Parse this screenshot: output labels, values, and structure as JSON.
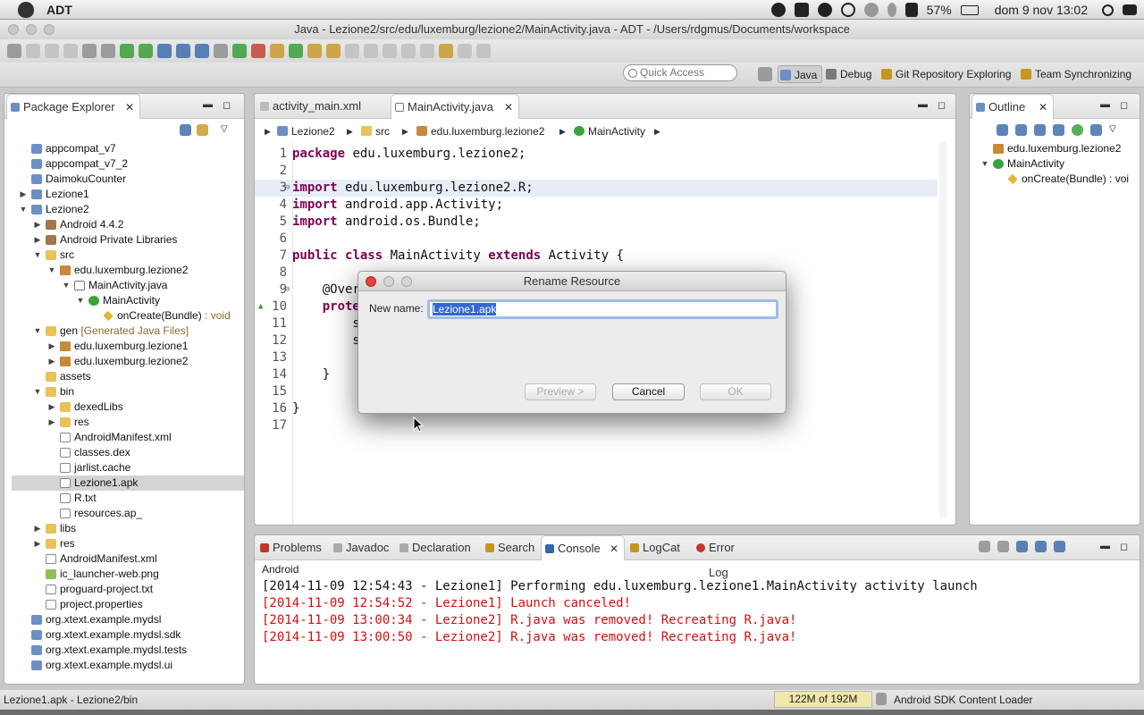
{
  "menubar": {
    "app": "ADT",
    "battery": "57%",
    "datetime": "dom 9 nov  13:02"
  },
  "window": {
    "title": "Java - Lezione2/src/edu/luxemburg/lezione2/MainActivity.java - ADT - /Users/rdgmus/Documents/workspace"
  },
  "toolbar": {
    "quick_access_placeholder": "Quick Access"
  },
  "perspectives": [
    {
      "label": "Java",
      "active": true
    },
    {
      "label": "Debug"
    },
    {
      "label": "Git Repository Exploring"
    },
    {
      "label": "Team Synchronizing"
    }
  ],
  "package_explorer": {
    "title": "Package Explorer",
    "items": [
      {
        "label": "appcompat_v7",
        "depth": 0,
        "icon": "project-icon"
      },
      {
        "label": "appcompat_v7_2",
        "depth": 0,
        "icon": "project-icon"
      },
      {
        "label": "DaimokuCounter",
        "depth": 0,
        "icon": "project-icon"
      },
      {
        "label": "Lezione1",
        "depth": 0,
        "icon": "project-icon",
        "twisty": "collapsed"
      },
      {
        "label": "Lezione2",
        "depth": 0,
        "icon": "project-icon",
        "twisty": "expanded"
      },
      {
        "label": "Android 4.4.2",
        "depth": 1,
        "icon": "library-icon",
        "twisty": "collapsed"
      },
      {
        "label": "Android Private Libraries",
        "depth": 1,
        "icon": "library-icon",
        "twisty": "collapsed"
      },
      {
        "label": "src",
        "depth": 1,
        "icon": "folder-icon",
        "twisty": "expanded"
      },
      {
        "label": "edu.luxemburg.lezione2",
        "depth": 2,
        "icon": "package-icon",
        "twisty": "expanded"
      },
      {
        "label": "MainActivity.java",
        "depth": 3,
        "icon": "java-file-icon",
        "twisty": "expanded"
      },
      {
        "label": "MainActivity",
        "depth": 4,
        "icon": "class-icon",
        "twisty": "expanded"
      },
      {
        "label": "onCreate(Bundle)",
        "decoration": " : void",
        "depth": 5,
        "icon": "method-icon"
      },
      {
        "label": "gen",
        "decoration": " [Generated Java Files]",
        "depth": 1,
        "icon": "folder-icon",
        "twisty": "expanded"
      },
      {
        "label": "edu.luxemburg.lezione1",
        "depth": 2,
        "icon": "package-icon",
        "twisty": "collapsed"
      },
      {
        "label": "edu.luxemburg.lezione2",
        "depth": 2,
        "icon": "package-icon",
        "twisty": "collapsed"
      },
      {
        "label": "assets",
        "depth": 1,
        "icon": "folder-icon"
      },
      {
        "label": "bin",
        "depth": 1,
        "icon": "folder-icon",
        "twisty": "expanded"
      },
      {
        "label": "dexedLibs",
        "depth": 2,
        "icon": "folder-icon",
        "twisty": "collapsed"
      },
      {
        "label": "res",
        "depth": 2,
        "icon": "folder-icon",
        "twisty": "collapsed"
      },
      {
        "label": "AndroidManifest.xml",
        "depth": 2,
        "icon": "file-icon"
      },
      {
        "label": "classes.dex",
        "depth": 2,
        "icon": "file-icon"
      },
      {
        "label": "jarlist.cache",
        "depth": 2,
        "icon": "file-icon"
      },
      {
        "label": "Lezione1.apk",
        "depth": 2,
        "icon": "file-icon",
        "selected": true
      },
      {
        "label": "R.txt",
        "depth": 2,
        "icon": "file-icon"
      },
      {
        "label": "resources.ap_",
        "depth": 2,
        "icon": "file-icon"
      },
      {
        "label": "libs",
        "depth": 1,
        "icon": "folder-icon",
        "twisty": "collapsed"
      },
      {
        "label": "res",
        "depth": 1,
        "icon": "folder-icon",
        "twisty": "collapsed"
      },
      {
        "label": "AndroidManifest.xml",
        "depth": 1,
        "icon": "file-icon"
      },
      {
        "label": "ic_launcher-web.png",
        "depth": 1,
        "icon": "image-icon"
      },
      {
        "label": "proguard-project.txt",
        "depth": 1,
        "icon": "file-icon"
      },
      {
        "label": "project.properties",
        "depth": 1,
        "icon": "file-icon"
      },
      {
        "label": "org.xtext.example.mydsl",
        "depth": 0,
        "icon": "project-icon"
      },
      {
        "label": "org.xtext.example.mydsl.sdk",
        "depth": 0,
        "icon": "project-icon"
      },
      {
        "label": "org.xtext.example.mydsl.tests",
        "depth": 0,
        "icon": "project-icon"
      },
      {
        "label": "org.xtext.example.mydsl.ui",
        "depth": 0,
        "icon": "project-icon"
      }
    ]
  },
  "editor": {
    "tabs": [
      {
        "label": "activity_main.xml",
        "active": false
      },
      {
        "label": "MainActivity.java",
        "active": true
      }
    ],
    "breadcrumb": [
      "Lezione2",
      "src",
      "edu.luxemburg.lezione2",
      "MainActivity"
    ],
    "lines": [
      {
        "n": "1",
        "parts": [
          {
            "kw": "package"
          },
          {
            "t": " edu.luxemburg.lezione2;"
          }
        ]
      },
      {
        "n": "2",
        "parts": []
      },
      {
        "n": "3",
        "fold": true,
        "hl": true,
        "parts": [
          {
            "kw": "import"
          },
          {
            "t": " edu.luxemburg.lezione2.R;"
          }
        ]
      },
      {
        "n": "4",
        "parts": [
          {
            "kw": "import"
          },
          {
            "t": " android.app.Activity;"
          }
        ]
      },
      {
        "n": "5",
        "parts": [
          {
            "kw": "import"
          },
          {
            "t": " android.os.Bundle;"
          }
        ]
      },
      {
        "n": "6",
        "parts": []
      },
      {
        "n": "7",
        "parts": [
          {
            "kw": "public"
          },
          {
            "t": " "
          },
          {
            "kw": "class"
          },
          {
            "t": " MainActivity "
          },
          {
            "kw": "extends"
          },
          {
            "t": " Activity {"
          }
        ]
      },
      {
        "n": "8",
        "parts": []
      },
      {
        "n": "9",
        "fold": true,
        "parts": [
          {
            "t": "    @Over"
          }
        ]
      },
      {
        "n": "10",
        "override": true,
        "parts": [
          {
            "t": "    "
          },
          {
            "kw": "prote"
          }
        ]
      },
      {
        "n": "11",
        "parts": [
          {
            "t": "        s"
          }
        ]
      },
      {
        "n": "12",
        "parts": [
          {
            "t": "        s"
          }
        ]
      },
      {
        "n": "13",
        "parts": []
      },
      {
        "n": "14",
        "parts": [
          {
            "t": "    }"
          }
        ]
      },
      {
        "n": "15",
        "parts": []
      },
      {
        "n": "16",
        "parts": [
          {
            "t": "}"
          }
        ]
      },
      {
        "n": "17",
        "parts": []
      }
    ]
  },
  "outline": {
    "title": "Outline",
    "items": [
      {
        "label": "edu.luxemburg.lezione2",
        "depth": 0,
        "icon": "package-icon"
      },
      {
        "label": "MainActivity",
        "depth": 0,
        "icon": "class-icon",
        "twisty": "expanded"
      },
      {
        "label": "onCreate(Bundle) : voi",
        "depth": 1,
        "icon": "method-icon"
      }
    ]
  },
  "dialog": {
    "title": "Rename Resource",
    "new_name_label": "New name:",
    "new_name_value": "Lezione1.apk",
    "preview_label": "Preview >",
    "cancel_label": "Cancel",
    "ok_label": "OK"
  },
  "bottom_panel": {
    "tabs": [
      {
        "label": "Problems"
      },
      {
        "label": "Javadoc"
      },
      {
        "label": "Declaration"
      },
      {
        "label": "Search"
      },
      {
        "label": "Console",
        "active": true
      },
      {
        "label": "LogCat"
      },
      {
        "label": "Error Log"
      }
    ],
    "console_name": "Android",
    "console_lines": [
      {
        "text": "[2014-11-09 12:54:43 - Lezione1] Performing edu.luxemburg.lezione1.MainActivity activity launch",
        "color": "#111111"
      },
      {
        "text": "[2014-11-09 12:54:52 - Lezione1] Launch canceled!",
        "color": "#d01010"
      },
      {
        "text": "[2014-11-09 13:00:34 - Lezione2] R.java was removed! Recreating R.java!",
        "color": "#d01010"
      },
      {
        "text": "[2014-11-09 13:00:50 - Lezione2] R.java was removed! Recreating R.java!",
        "color": "#d01010"
      }
    ]
  },
  "status": {
    "left_text": "Lezione1.apk - Lezione2/bin",
    "heap": "122M of 192M",
    "job": "Android SDK Content Loader"
  }
}
